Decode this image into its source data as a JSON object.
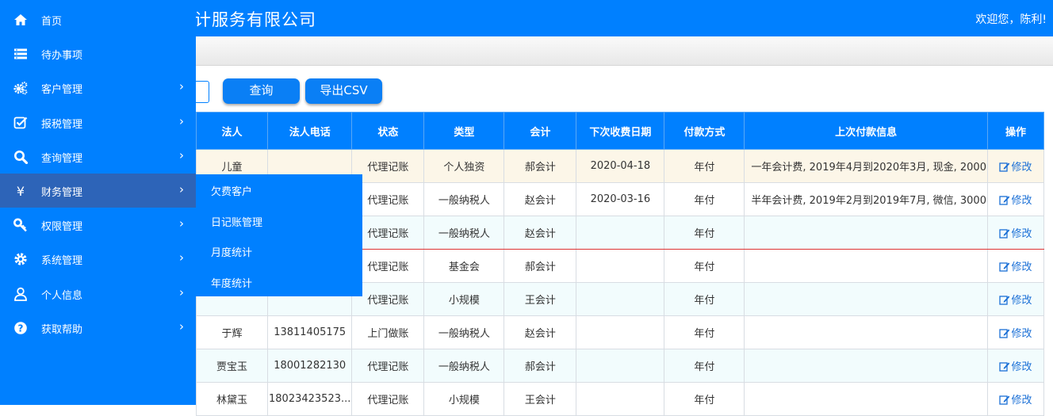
{
  "header": {
    "title": "计服务有限公司",
    "welcome": "欢迎您，陈利!"
  },
  "toolbar": {
    "query_label": "查询",
    "export_label": "导出CSV"
  },
  "sidebar": {
    "items": [
      {
        "label": "首页",
        "icon": "home-icon",
        "has_arrow": false
      },
      {
        "label": "待办事项",
        "icon": "list-icon",
        "has_arrow": false
      },
      {
        "label": "客户管理",
        "icon": "gears-icon",
        "has_arrow": true
      },
      {
        "label": "报税管理",
        "icon": "checkbox-icon",
        "has_arrow": true
      },
      {
        "label": "查询管理",
        "icon": "search-icon",
        "has_arrow": true
      },
      {
        "label": "财务管理",
        "icon": "yen-icon",
        "has_arrow": true,
        "active": true
      },
      {
        "label": "权限管理",
        "icon": "key-icon",
        "has_arrow": true
      },
      {
        "label": "系统管理",
        "icon": "gear-icon",
        "has_arrow": true
      },
      {
        "label": "个人信息",
        "icon": "user-icon",
        "has_arrow": true
      },
      {
        "label": "获取帮助",
        "icon": "help-icon",
        "has_arrow": true
      }
    ],
    "arrow": "›",
    "submenu": [
      "欠费客户",
      "日记账管理",
      "月度统计",
      "年度统计"
    ]
  },
  "table": {
    "columns": [
      "法人",
      "法人电话",
      "状态",
      "类型",
      "会计",
      "下次收费日期",
      "付款方式",
      "上次付款信息",
      "操作"
    ],
    "edit_label": "修改",
    "rows": [
      [
        "儿童",
        "",
        "代理记账",
        "个人独资",
        "郝会计",
        "2020-04-18",
        "年付",
        "一年会计费, 2019年4月到2020年3月, 现金, 2000"
      ],
      [
        "",
        "",
        "代理记账",
        "一般纳税人",
        "赵会计",
        "2020-03-16",
        "年付",
        "半年会计费, 2019年2月到2019年7月, 微信, 3000"
      ],
      [
        "",
        "",
        "代理记账",
        "一般纳税人",
        "赵会计",
        "",
        "年付",
        ""
      ],
      [
        "",
        "",
        "代理记账",
        "基金会",
        "郝会计",
        "",
        "年付",
        ""
      ],
      [
        "",
        "",
        "代理记账",
        "小规模",
        "王会计",
        "",
        "年付",
        ""
      ],
      [
        "于辉",
        "13811405175",
        "上门做账",
        "一般纳税人",
        "赵会计",
        "",
        "年付",
        ""
      ],
      [
        "贾宝玉",
        "18001282130",
        "代理记账",
        "一般纳税人",
        "郝会计",
        "",
        "年付",
        ""
      ],
      [
        "林黛玉",
        "18023423523...",
        "代理记账",
        "小规模",
        "王会计",
        "",
        "年付",
        ""
      ]
    ]
  },
  "colors": {
    "primary": "#0080ff",
    "active_nav": "#2d64b8",
    "row_highlight": "#fcf6e8",
    "row_alt": "#f2fcfd"
  }
}
